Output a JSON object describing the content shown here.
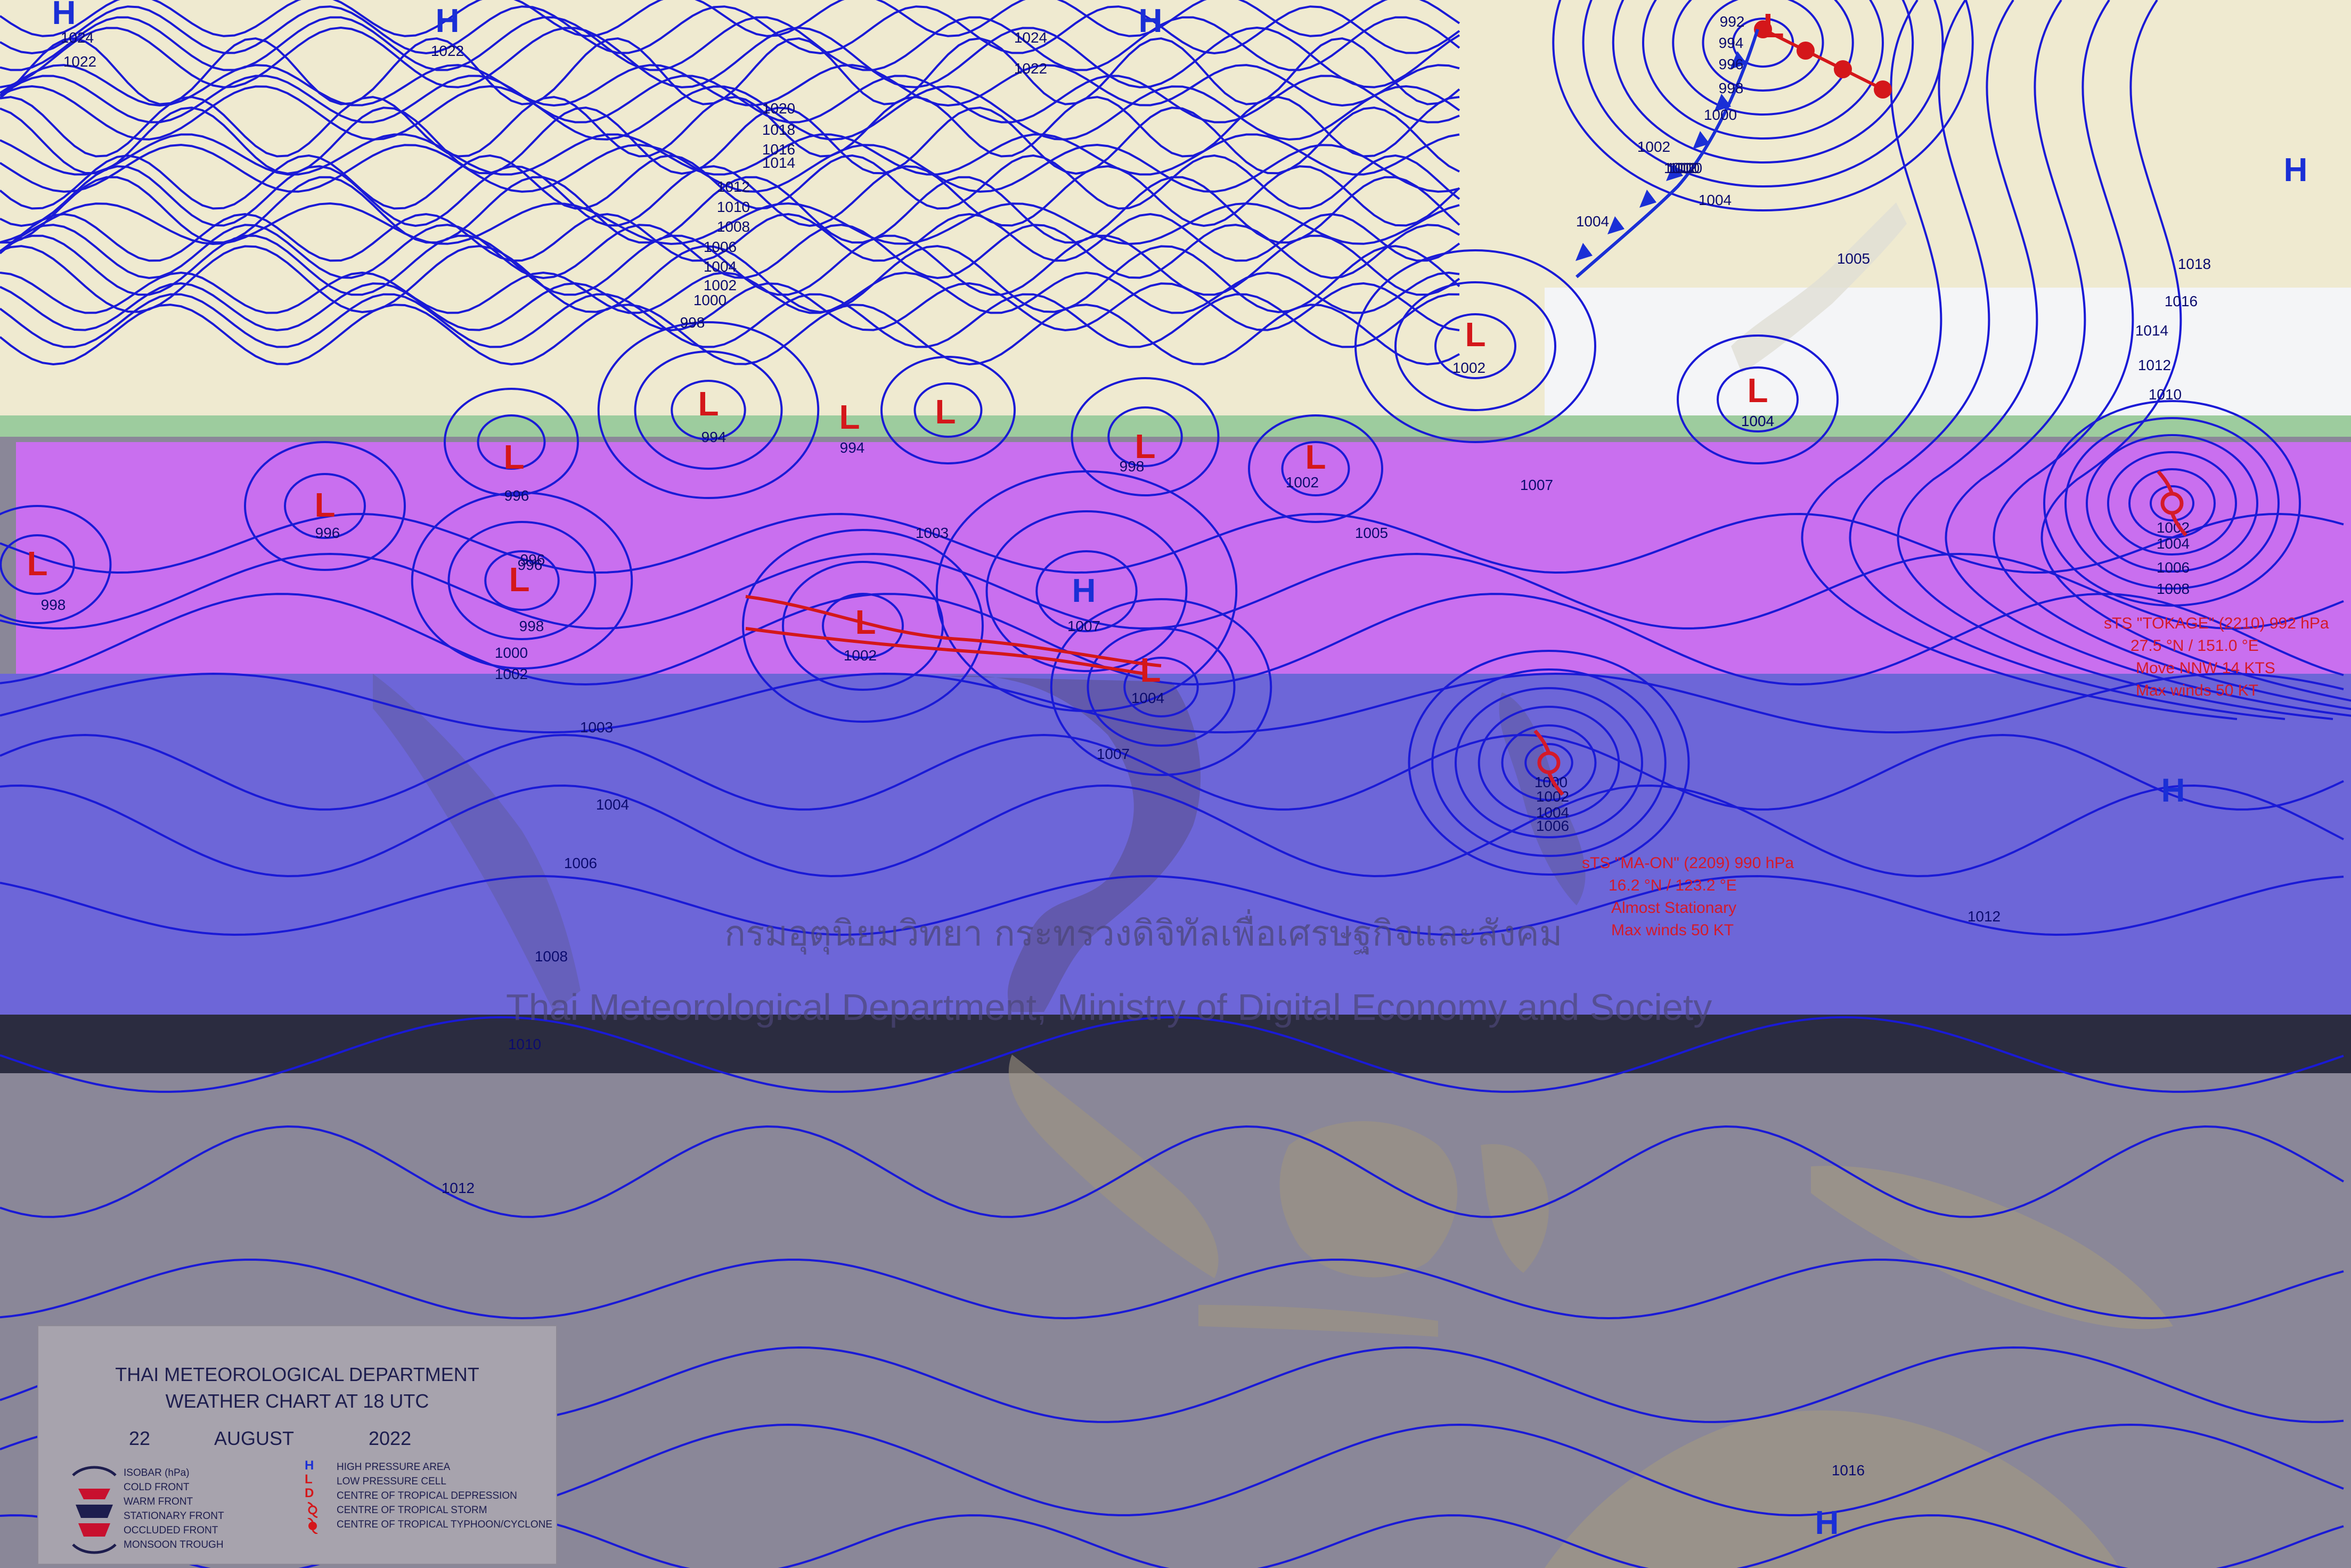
{
  "map": {
    "watermark_thai": "กรมอุตุนิยมวิทยา กระทรวงดิจิทัลเพื่อเศรษฐกิจและสังคม",
    "watermark_english": "Thai Meteorological Department, Ministry of Digital Economy and Society",
    "colors": {
      "isobar": "#1a1ad6",
      "pressure_label": "#0b0b6e",
      "high_marker": "#1a2fd6",
      "low_marker": "#d4171a",
      "storm_text": "#d41a2a",
      "band_magenta": "#c96fef",
      "band_blue": "#6d66d8",
      "band_dark": "#2b2c40",
      "band_gray": "#8a8798",
      "land_top": "#efead0"
    },
    "high_markers": [
      {
        "letter": "H"
      },
      {
        "letter": "H"
      },
      {
        "letter": "H"
      },
      {
        "letter": "H"
      },
      {
        "letter": "H"
      },
      {
        "letter": "H"
      },
      {
        "letter": "H"
      }
    ],
    "low_markers": [
      {
        "letter": "L"
      },
      {
        "letter": "L"
      },
      {
        "letter": "L"
      },
      {
        "letter": "L"
      },
      {
        "letter": "L"
      },
      {
        "letter": "L"
      },
      {
        "letter": "L"
      },
      {
        "letter": "L"
      },
      {
        "letter": "L"
      },
      {
        "letter": "L"
      },
      {
        "letter": "L"
      },
      {
        "letter": "L"
      },
      {
        "letter": "L"
      },
      {
        "letter": "L"
      }
    ],
    "isobar_labels": [
      "1024",
      "1022",
      "1022",
      "1024",
      "1022",
      "1020",
      "1018",
      "1016",
      "1014",
      "1012",
      "1010",
      "1008",
      "1006",
      "1004",
      "1002",
      "1000",
      "998",
      "994",
      "994",
      "996",
      "998",
      "1002",
      "1002",
      "1004",
      "996",
      "996",
      "998",
      "1000",
      "1002",
      "998",
      "996",
      "1003",
      "1002",
      "1007",
      "1004",
      "1005",
      "1007",
      "1003",
      "1004",
      "1006",
      "1008",
      "1010",
      "1012",
      "1007",
      "1000",
      "1002",
      "1004",
      "1006",
      "1012",
      "1002",
      "1004",
      "1006",
      "1008",
      "1010",
      "1012",
      "1014",
      "1016",
      "1018",
      "1005",
      "1004",
      "1000",
      "1002",
      "1004",
      "1016",
      "992",
      "994",
      "996",
      "998",
      "1000",
      "1002",
      "1004",
      "1000"
    ],
    "storms": [
      {
        "lines": [
          "sTS \"TOKAGE\" (2210) 992 hPa",
          "27.5 °N / 151.0 °E",
          "Move NNW 14 KTS",
          "Max winds 50 KT"
        ]
      },
      {
        "lines": [
          "sTS \"MA-ON\" (2209) 990 hPa",
          "16.2 °N / 123.2 °E",
          "Almost Stationary",
          "Max winds 50 KT"
        ]
      }
    ]
  },
  "legend": {
    "title_line1": "THAI METEOROLOGICAL DEPARTMENT",
    "title_line2": "WEATHER CHART AT  18  UTC",
    "day": "22",
    "month": "AUGUST",
    "year": "2022",
    "left_items": [
      "ISOBAR (hPa)",
      "COLD FRONT",
      "WARM FRONT",
      "STATIONARY FRONT",
      "OCCLUDED FRONT",
      "MONSOON TROUGH"
    ],
    "right_items": [
      "HIGH PRESSURE AREA",
      "LOW PRESSURE CELL",
      "CENTRE OF TROPICAL DEPRESSION",
      "CENTRE OF TROPICAL STORM",
      "CENTRE OF TROPICAL TYPHOON/CYCLONE"
    ],
    "right_symbols": [
      "H",
      "L",
      "D"
    ]
  }
}
